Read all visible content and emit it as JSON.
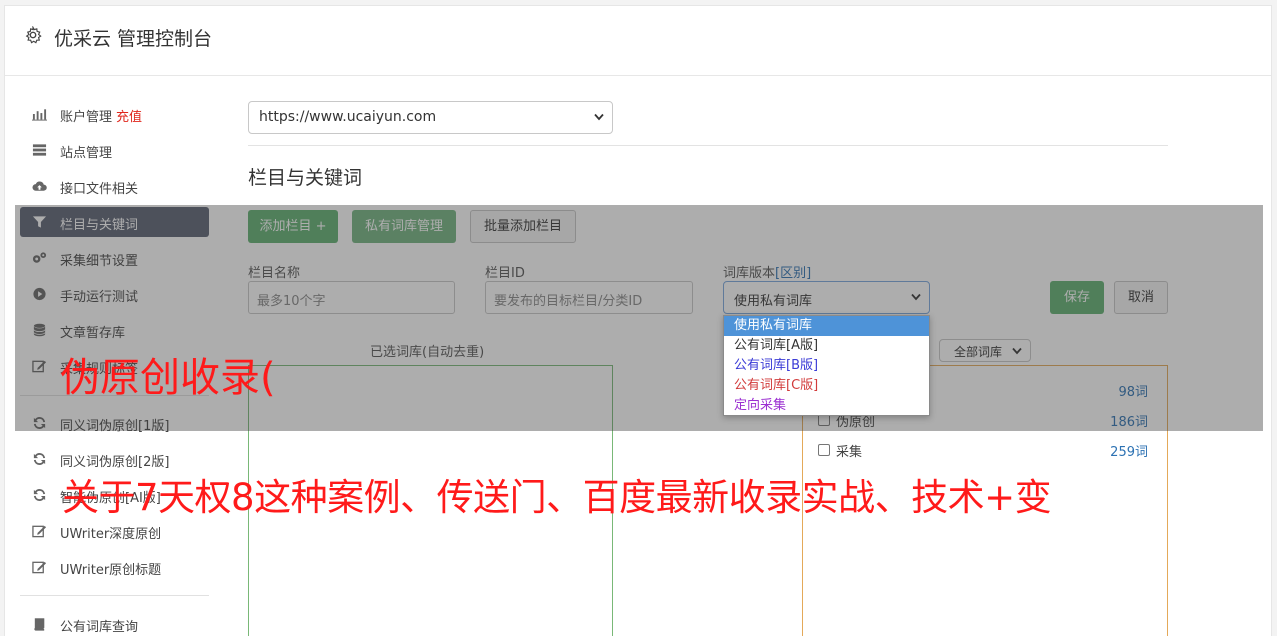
{
  "header": {
    "title": "优采云 管理控制台",
    "icon": "gear-icon"
  },
  "sidebar": {
    "items": [
      {
        "label": "账户管理",
        "badge": "充值",
        "icon": "bar-chart-icon"
      },
      {
        "label": "站点管理",
        "icon": "server-icon"
      },
      {
        "label": "接口文件相关",
        "icon": "cloud-upload-icon"
      },
      {
        "label": "栏目与关键词",
        "icon": "filter-icon",
        "active": true
      },
      {
        "label": "采集细节设置",
        "icon": "gears-icon"
      },
      {
        "label": "手动运行测试",
        "icon": "play-circle-icon"
      },
      {
        "label": "文章暂存库",
        "icon": "database-icon"
      },
      {
        "label": "采集规则标签",
        "icon": "edit-icon"
      },
      {
        "label": "同义词伪原创[1版]",
        "icon": "refresh-icon"
      },
      {
        "label": "同义词伪原创[2版]",
        "icon": "refresh-icon"
      },
      {
        "label": "智能伪原创[AI版]",
        "icon": "refresh-icon"
      },
      {
        "label": "UWriter深度原创",
        "icon": "edit-icon"
      },
      {
        "label": "UWriter原创标题",
        "icon": "edit-icon"
      },
      {
        "label": "公有词库查询",
        "icon": "book-icon"
      }
    ]
  },
  "main": {
    "site_select": "https://www.ucaiyun.com",
    "section_title": "栏目与关键词",
    "buttons": {
      "add_column": "添加栏目 +",
      "private_lib": "私有词库管理",
      "batch_add": "批量添加栏目",
      "save": "保存",
      "cancel": "取消"
    },
    "fields": {
      "name_label": "栏目名称",
      "name_placeholder": "最多10个字",
      "id_label": "栏目ID",
      "id_placeholder": "要发布的目标栏目/分类ID",
      "version_label": "词库版本",
      "version_link": "[区别]",
      "version_value": "使用私有词库"
    },
    "dropdown_options": [
      {
        "label": "使用私有词库",
        "color": "#ffffff"
      },
      {
        "label": "公有词库[A版]",
        "color": "#333333"
      },
      {
        "label": "公有词库[B版]",
        "color": "#3b3bd6"
      },
      {
        "label": "公有词库[C版]",
        "color": "#d23c3c"
      },
      {
        "label": "定向采集",
        "color": "#9b2fd1"
      }
    ],
    "selected_panel_label": "已选词库(自动去重)",
    "all_lib_select": "全部词库",
    "libraries": [
      {
        "name": "",
        "count": "98词"
      },
      {
        "name": "伪原创",
        "count": "186词"
      },
      {
        "name": "采集",
        "count": "259词"
      }
    ]
  },
  "watermarks": {
    "line1": "伪原创收录(",
    "line2": "关于7天权8这种案例、传送门、百度最新收录实战、技术+变"
  },
  "colors": {
    "accent_green": "#5fb070",
    "active_nav": "#5a6172",
    "watermark": "#ff1a1a",
    "link": "#2d72b3"
  }
}
